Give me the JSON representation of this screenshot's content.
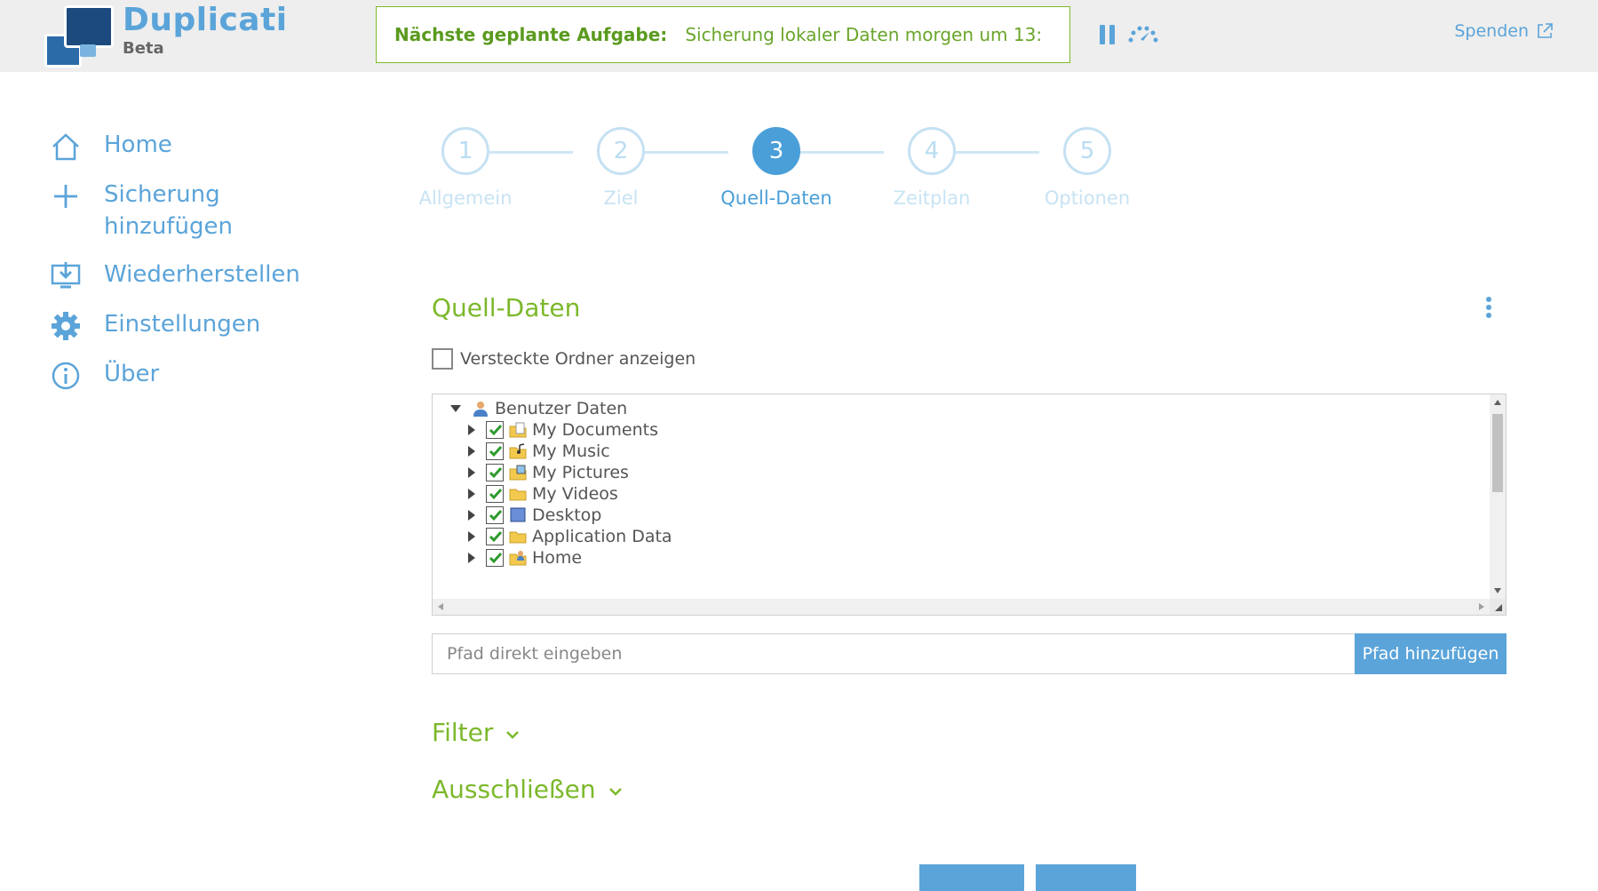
{
  "header": {
    "brand": "Duplicati",
    "brand_sub": "Beta",
    "status_label": "Nächste geplante Aufgabe:",
    "status_text": "Sicherung lokaler Daten morgen um 13:",
    "donate_label": "Spenden"
  },
  "sidebar": {
    "items": [
      {
        "label": "Home",
        "icon": "home-icon"
      },
      {
        "label": "Sicherung hinzufügen",
        "icon": "plus-icon"
      },
      {
        "label": "Wiederherstellen",
        "icon": "restore-icon"
      },
      {
        "label": "Einstellungen",
        "icon": "gear-icon"
      },
      {
        "label": "Über",
        "icon": "info-icon"
      }
    ]
  },
  "stepper": {
    "steps": [
      {
        "number": "1",
        "label": "Allgemein"
      },
      {
        "number": "2",
        "label": "Ziel"
      },
      {
        "number": "3",
        "label": "Quell-Daten"
      },
      {
        "number": "4",
        "label": "Zeitplan"
      },
      {
        "number": "5",
        "label": "Optionen"
      }
    ],
    "active_index": 2
  },
  "main": {
    "title": "Quell-Daten",
    "show_hidden_label": "Versteckte Ordner anzeigen",
    "tree": {
      "root": "Benutzer Daten",
      "children": [
        "My Documents",
        "My Music",
        "My Pictures",
        "My Videos",
        "Desktop",
        "Application Data",
        "Home"
      ]
    },
    "path_placeholder": "Pfad direkt eingeben",
    "add_path_label": "Pfad hinzufügen",
    "filter_label": "Filter",
    "exclude_label": "Ausschließen"
  },
  "colors": {
    "accent_blue": "#5ba4d9",
    "accent_green": "#7cb82b"
  }
}
